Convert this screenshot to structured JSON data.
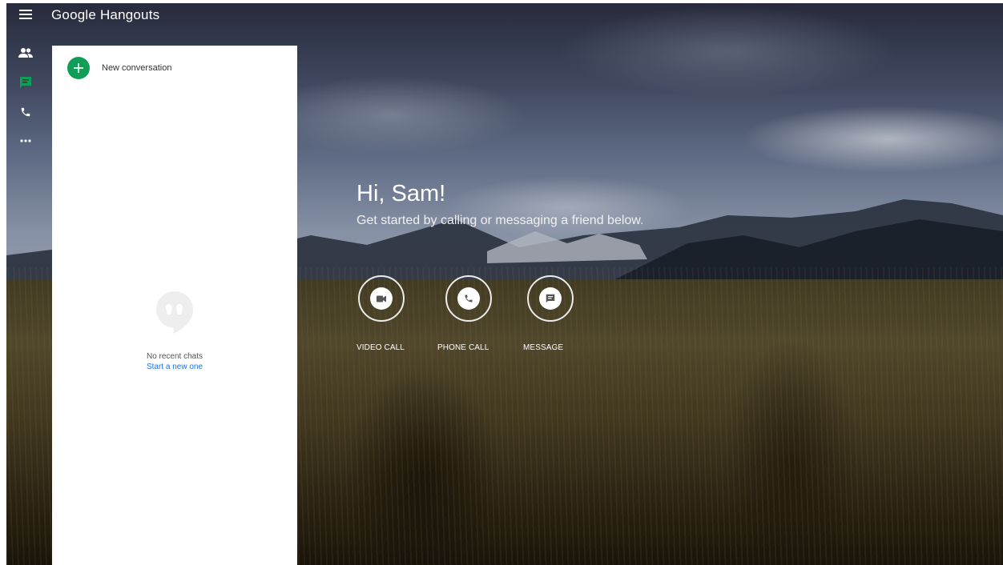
{
  "app": {
    "title": "Google Hangouts"
  },
  "rail": {
    "items": [
      {
        "name": "contacts",
        "icon": "people-icon",
        "active": false
      },
      {
        "name": "conversations",
        "icon": "chat-icon",
        "active": true
      },
      {
        "name": "phone-calls",
        "icon": "phone-icon",
        "active": false
      },
      {
        "name": "more",
        "icon": "more-horiz-icon",
        "active": false
      }
    ]
  },
  "panel": {
    "new_conversation_label": "New conversation",
    "empty_title": "No recent chats",
    "empty_link": "Start a new one"
  },
  "greeting": {
    "title": "Hi, Sam!",
    "subtitle": "Get started by calling or messaging a friend below."
  },
  "actions": [
    {
      "label": "VIDEO CALL",
      "icon": "videocam-icon"
    },
    {
      "label": "PHONE CALL",
      "icon": "phone-icon"
    },
    {
      "label": "MESSAGE",
      "icon": "message-icon"
    }
  ],
  "colors": {
    "accent_green": "#0f9d58",
    "link_blue": "#1a73e8"
  }
}
